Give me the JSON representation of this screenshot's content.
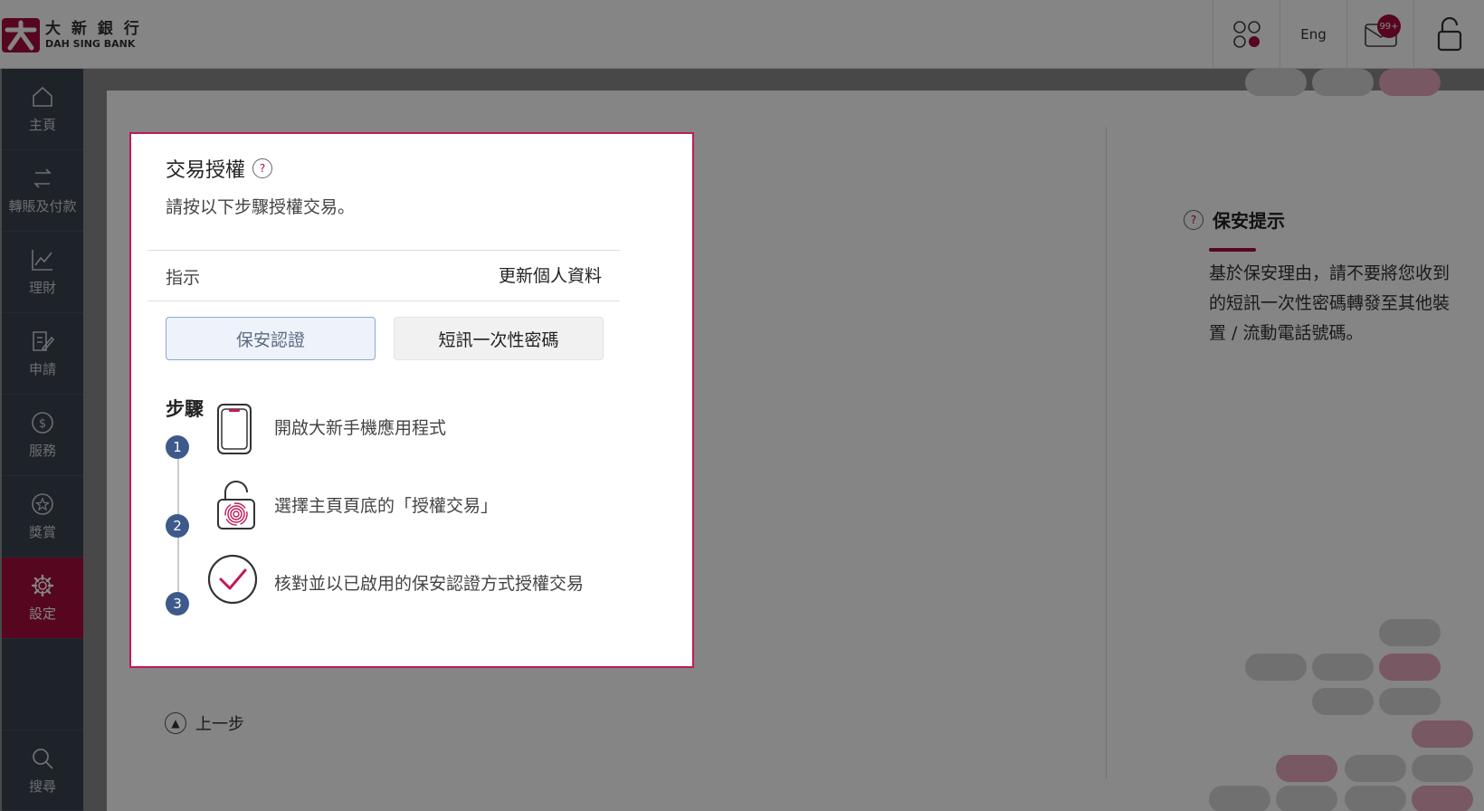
{
  "header": {
    "logo_zh": "大 新 銀 行",
    "logo_en": "DAH SING BANK",
    "lang_label": "Eng",
    "mail_badge": "99+"
  },
  "sidebar": {
    "items": [
      {
        "label": "主頁",
        "icon": "home-icon"
      },
      {
        "label": "轉賬及付款",
        "icon": "transfer-icon"
      },
      {
        "label": "理財",
        "icon": "chart-icon"
      },
      {
        "label": "申請",
        "icon": "edit-icon"
      },
      {
        "label": "服務",
        "icon": "dollar-icon"
      },
      {
        "label": "獎賞",
        "icon": "star-icon"
      },
      {
        "label": "設定",
        "icon": "gear-icon",
        "active": true
      },
      {
        "label": "搜尋",
        "icon": "search-icon"
      }
    ]
  },
  "page": {
    "tips_title": "保安提示",
    "tips_text": "基於保安理由，請不要將您收到的短訊一次性密碼轉發至其他裝置 / 流動電話號碼。",
    "back_label": "上一步"
  },
  "modal": {
    "title": "交易授權",
    "help_icon": "?",
    "description": "請按以下步驟授權交易。",
    "instruction_label": "指示",
    "instruction_value": "更新個人資料",
    "primary_button": "保安認證",
    "secondary_button": "短訊一次性密碼",
    "steps_heading": "步驟",
    "steps": [
      {
        "number": "1",
        "text": "開啟大新手機應用程式",
        "icon": "phone-icon"
      },
      {
        "number": "2",
        "text": "選擇主頁頁底的「授權交易」",
        "icon": "fingerprint-lock-icon"
      },
      {
        "number": "3",
        "text": "核對並以已啟用的保安認證方式授權交易",
        "icon": "checkmark-circle-icon"
      }
    ]
  },
  "colors": {
    "brand": "#a50f3c",
    "sidebar": "#3b4350",
    "step_badge": "#3e5a8a",
    "modal_border": "#c2185b"
  }
}
